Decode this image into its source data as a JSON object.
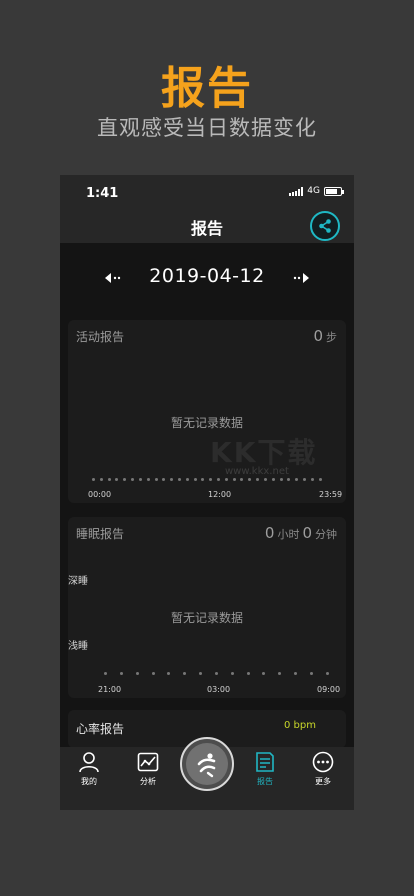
{
  "promo": {
    "title": "报告",
    "subtitle": "直观感受当日数据变化"
  },
  "status_bar": {
    "time": "1:41",
    "network": "4G"
  },
  "header": {
    "title": "报告",
    "share_icon": "share-icon"
  },
  "date_nav": {
    "date": "2019-04-12",
    "prev_icon": "arrow-left-icon",
    "next_icon": "arrow-right-icon"
  },
  "activity_report": {
    "title": "活动报告",
    "steps": "0",
    "steps_unit": "步",
    "empty_text": "暂无记录数据",
    "ticks": [
      "00:00",
      "12:00",
      "23:59"
    ]
  },
  "sleep_report": {
    "title": "睡眠报告",
    "hours": "0",
    "hours_unit": "小时",
    "minutes": "0",
    "minutes_unit": "分钟",
    "deep_label": "深睡",
    "light_label": "浅睡",
    "empty_text": "暂无记录数据",
    "ticks": [
      "21:00",
      "03:00",
      "09:00"
    ]
  },
  "heart_report": {
    "title": "心率报告",
    "value": "0 bpm"
  },
  "watermark": {
    "text": "KK下载",
    "url": "www.kkx.net"
  },
  "tabbar": {
    "items": [
      {
        "label": "我的",
        "icon": "person-icon"
      },
      {
        "label": "分析",
        "icon": "chart-icon"
      },
      {
        "label": "",
        "icon": "runner-icon"
      },
      {
        "label": "报告",
        "icon": "report-icon"
      },
      {
        "label": "更多",
        "icon": "more-icon"
      }
    ]
  },
  "colors": {
    "accent": "#20b6c3",
    "promo": "#f5a21c",
    "heart_value": "#c8d62a"
  }
}
